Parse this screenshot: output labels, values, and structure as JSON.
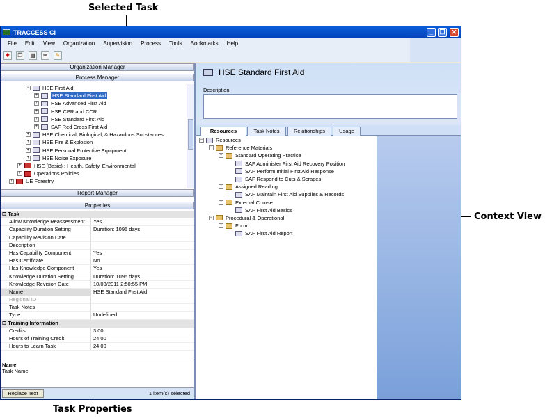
{
  "callouts": {
    "selected_task": "Selected Task",
    "context_view": "Context View",
    "task_properties": "Task Properties"
  },
  "window": {
    "title": "TRACCESS CI"
  },
  "menu": [
    "File",
    "Edit",
    "View",
    "Organization",
    "Supervision",
    "Process",
    "Tools",
    "Bookmarks",
    "Help"
  ],
  "left": {
    "organization_manager": "Organization Manager",
    "process_manager": "Process Manager",
    "report_manager": "Report Manager",
    "properties": "Properties",
    "tree": [
      {
        "label": "HSE  First Aid",
        "level": 3,
        "pm": "−",
        "icon": "doc-folder-icon"
      },
      {
        "label": "HSE  Standard First Aid",
        "level": 4,
        "pm": "+",
        "icon": "task-icon",
        "selected": true
      },
      {
        "label": "HSE  Advanced First Aid",
        "level": 4,
        "pm": "+",
        "icon": "task-icon"
      },
      {
        "label": "HSE  CPR and CCR",
        "level": 4,
        "pm": "+",
        "icon": "task-icon"
      },
      {
        "label": "HSE  Standard First Aid",
        "level": 4,
        "pm": "+",
        "icon": "task-icon"
      },
      {
        "label": "SAF  Red Cross First Aid",
        "level": 4,
        "pm": "+",
        "icon": "task-icon"
      },
      {
        "label": "HSE  Chemical, Biological, & Hazardous Substances",
        "level": 3,
        "pm": "+",
        "icon": "doc-folder-icon"
      },
      {
        "label": "HSE  Fire & Explosion",
        "level": 3,
        "pm": "+",
        "icon": "doc-folder-icon"
      },
      {
        "label": "HSE  Personal Protective Equipment",
        "level": 3,
        "pm": "+",
        "icon": "doc-folder-icon"
      },
      {
        "label": "HSE  Noise Exposure",
        "level": 3,
        "pm": "+",
        "icon": "doc-folder-icon"
      },
      {
        "label": "HSE (Basic) : Health, Safety, Environmental",
        "level": 2,
        "pm": "+",
        "icon": "red-folder-icon"
      },
      {
        "label": "Operations Policies",
        "level": 2,
        "pm": "+",
        "icon": "red-folder-icon"
      },
      {
        "label": "UE Forestry",
        "level": 1,
        "pm": "+",
        "icon": "red-folder-icon"
      }
    ],
    "property_groups": [
      {
        "category": "Task",
        "rows": [
          {
            "k": "Allow Knowledge Reassessment",
            "v": "Yes"
          },
          {
            "k": "Capability Duration Setting",
            "v": "Duration: 1095 days"
          },
          {
            "k": "Capability Revision Date",
            "v": ""
          },
          {
            "k": "Description",
            "v": ""
          },
          {
            "k": "Has Capability Component",
            "v": "Yes"
          },
          {
            "k": "Has Certificate",
            "v": "No"
          },
          {
            "k": "Has Knowledge Component",
            "v": "Yes"
          },
          {
            "k": "Knowledge Duration Setting",
            "v": "Duration: 1095 days"
          },
          {
            "k": "Knowledge Revision Date",
            "v": "10/03/2011 2:50:55 PM"
          },
          {
            "k": "Name",
            "v": "HSE  Standard First Aid",
            "hl": true
          },
          {
            "k": "Regional ID",
            "v": "",
            "grey": true
          },
          {
            "k": "Task Notes",
            "v": ""
          },
          {
            "k": "Type",
            "v": "Undefined"
          }
        ]
      },
      {
        "category": "Training Information",
        "rows": [
          {
            "k": "Credits",
            "v": "3.00"
          },
          {
            "k": "Hours of Training Credit",
            "v": "24.00"
          },
          {
            "k": "Hours to Learn Task",
            "v": "24.00"
          }
        ]
      }
    ],
    "desc_title": "Name",
    "desc_text": "Task Name",
    "replace_text": "Replace Text",
    "selected_count": "1 item(s) selected"
  },
  "right": {
    "title": "HSE  Standard First Aid",
    "description_label": "Description",
    "tabs": [
      "Resources",
      "Task Notes",
      "Relationships",
      "Usage"
    ],
    "resources": [
      {
        "label": "Resources",
        "level": 0,
        "pm": "−",
        "icon": "resources-icon"
      },
      {
        "label": "Reference Materials",
        "level": 1,
        "pm": "−",
        "icon": "box-icon"
      },
      {
        "label": "Standard Operating Practice",
        "level": 2,
        "pm": "−",
        "icon": "folder-icon"
      },
      {
        "label": "SAF  Administer First Aid Recovery Position",
        "level": 3,
        "pm": "",
        "icon": "document-icon"
      },
      {
        "label": "SAF  Perform Initial First Aid Response",
        "level": 3,
        "pm": "",
        "icon": "document-icon"
      },
      {
        "label": "SAF  Respond to Cuts & Scrapes",
        "level": 3,
        "pm": "",
        "icon": "document-icon"
      },
      {
        "label": "Assigned Reading",
        "level": 2,
        "pm": "−",
        "icon": "folder-icon"
      },
      {
        "label": "SAF  Maintain First Aid Supplies & Records",
        "level": 3,
        "pm": "",
        "icon": "document-icon"
      },
      {
        "label": "External Course",
        "level": 2,
        "pm": "−",
        "icon": "folder-icon"
      },
      {
        "label": "SAF  First Aid Basics",
        "level": 3,
        "pm": "",
        "icon": "document-icon"
      },
      {
        "label": "Procedural & Operational",
        "level": 1,
        "pm": "−",
        "icon": "box-icon"
      },
      {
        "label": "Form",
        "level": 2,
        "pm": "−",
        "icon": "folder-icon"
      },
      {
        "label": "SAF  First Aid Report",
        "level": 3,
        "pm": "",
        "icon": "document-icon"
      }
    ]
  },
  "colors": {
    "titlebar": "#0442b8",
    "selection": "#316ac5",
    "context_view": "#7aa0da"
  }
}
